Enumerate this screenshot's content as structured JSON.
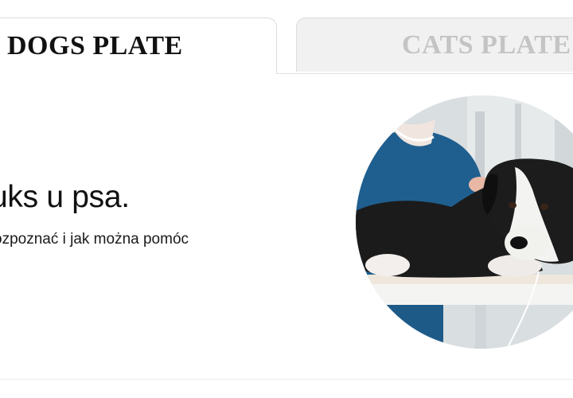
{
  "tabs": [
    {
      "label": "DOGS PLATE",
      "active": true
    },
    {
      "label": "CATS PLATE",
      "active": false
    }
  ],
  "main": {
    "heading": "uks u psa.",
    "subtext": "ozpoznać i jak można pomóc"
  },
  "photo": {
    "subject": "black-and-white dog lying on a veterinary examination table",
    "icon": "dog-photo"
  },
  "colors": {
    "active_tab_text": "#111111",
    "inactive_tab_text": "#c4c4c4",
    "inactive_tab_bg": "#f1f1f1",
    "scrubs": "#1f5f8f"
  }
}
